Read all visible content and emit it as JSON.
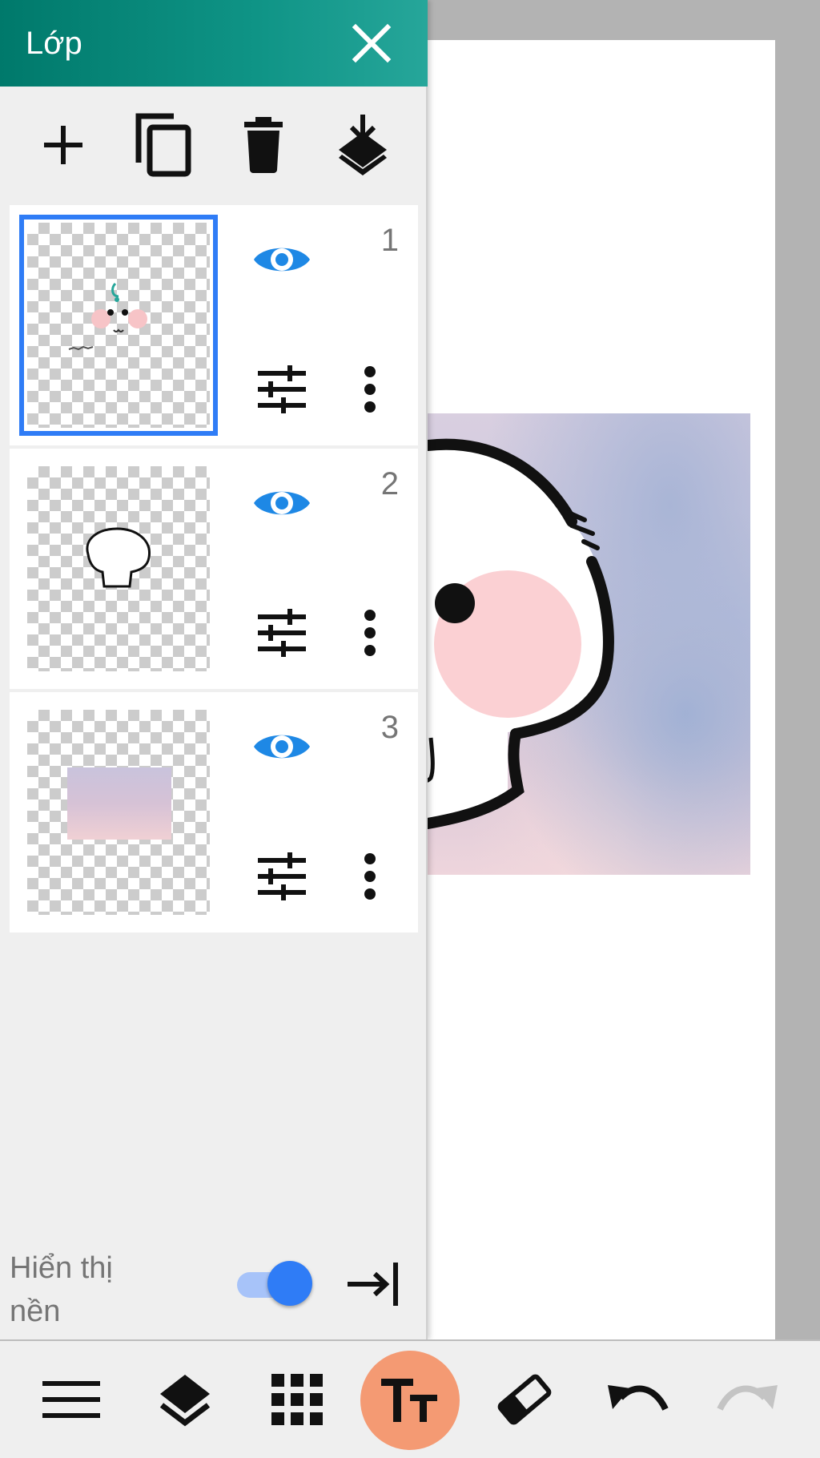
{
  "app": {
    "accent_color": "#00897b",
    "selection_color": "#2f7cf6",
    "eye_color": "#1e88e5",
    "text_tool_color": "#f49a73"
  },
  "layers_panel": {
    "title": "Lớp",
    "toolbar": {
      "add_icon": "plus-icon",
      "duplicate_icon": "copy-icon",
      "delete_icon": "trash-icon",
      "merge_down_icon": "merge-down-icon"
    },
    "layers": [
      {
        "number": "1",
        "visible": true,
        "selected": true
      },
      {
        "number": "2",
        "visible": true,
        "selected": false
      },
      {
        "number": "3",
        "visible": true,
        "selected": false
      }
    ],
    "show_background": {
      "label": "Hiển thị nền",
      "enabled": true
    }
  },
  "bottom_toolbar": {
    "items": [
      {
        "icon": "menu-icon"
      },
      {
        "icon": "layers-icon"
      },
      {
        "icon": "grid-icon"
      },
      {
        "icon": "text-tool-icon",
        "active": true
      },
      {
        "icon": "eraser-icon"
      },
      {
        "icon": "undo-icon"
      },
      {
        "icon": "redo-icon",
        "enabled": false
      }
    ]
  }
}
